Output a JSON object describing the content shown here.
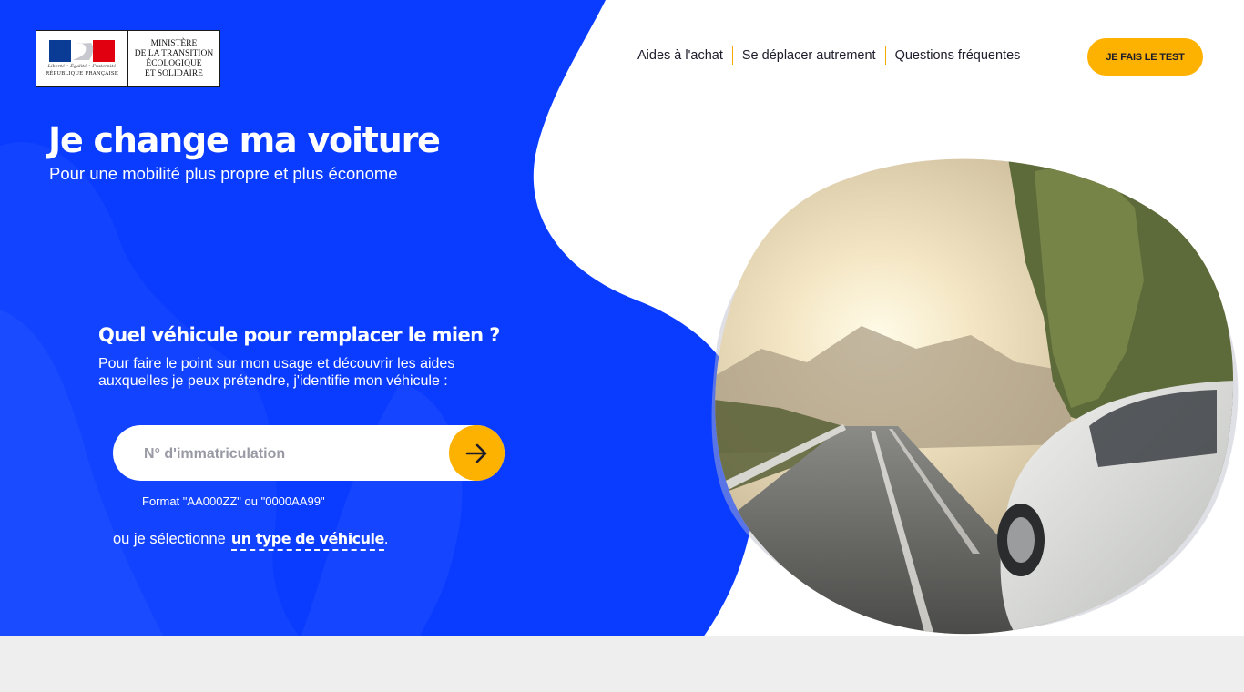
{
  "colors": {
    "primary_blue": "#0a3cff",
    "accent_yellow": "#fdb100",
    "text_dark": "#1c1c2b",
    "footer_grey": "#eeeeee"
  },
  "logo": {
    "motto": "Liberté • Égalité • Fraternité",
    "republic": "RÉPUBLIQUE FRANÇAISE",
    "ministry_lines": [
      "MINISTÈRE",
      "DE LA TRANSITION",
      "ÉCOLOGIQUE",
      "ET SOLIDAIRE"
    ]
  },
  "nav": {
    "items": [
      "Aides à l'achat",
      "Se déplacer autrement",
      "Questions fréquentes"
    ],
    "cta_label": "JE FAIS LE TEST"
  },
  "hero": {
    "title": "Je change ma voiture",
    "subtitle": "Pour une mobilité plus propre et plus économe"
  },
  "vehicle_form": {
    "question": "Quel véhicule pour remplacer le mien ?",
    "description": "Pour faire le point sur mon usage et découvrir les aides auxquelles je peux prétendre, j'identifie mon véhicule :",
    "input_placeholder": "N° d'immatriculation",
    "input_value": "",
    "format_hint": "Format \"AA000ZZ\" ou \"0000AA99\"",
    "alt_prefix": "ou je sélectionne",
    "alt_link": "un type de véhicule",
    "alt_suffix": "."
  },
  "icons": {
    "submit": "arrow-right-icon",
    "photo": "car-road-photo"
  }
}
